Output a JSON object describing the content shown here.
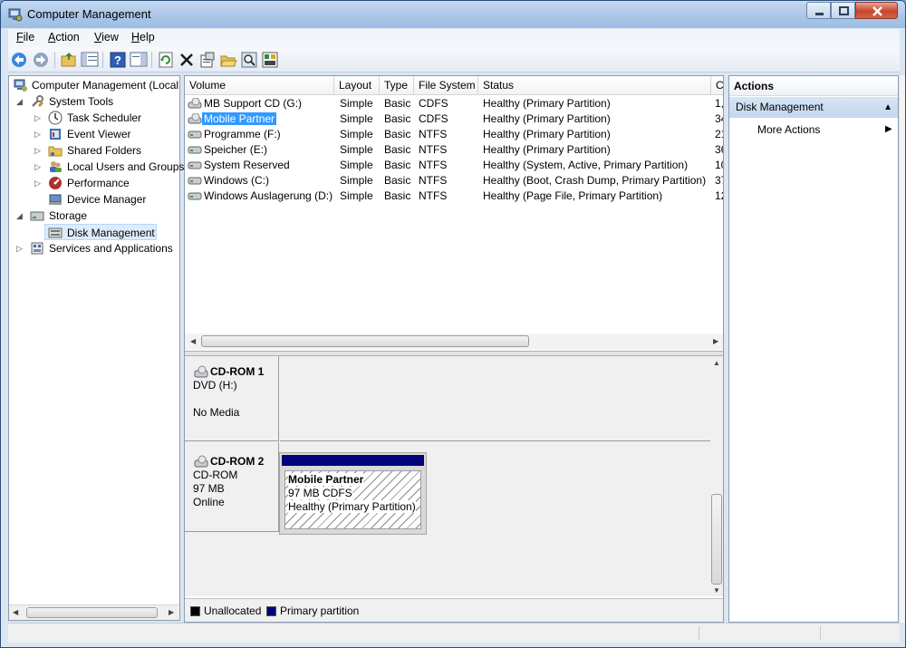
{
  "window": {
    "title": "Computer Management"
  },
  "menu": [
    {
      "label": "File",
      "ul": "F",
      "rest": "ile"
    },
    {
      "label": "Action",
      "ul": "A",
      "rest": "ction"
    },
    {
      "label": "View",
      "ul": "V",
      "rest": "iew"
    },
    {
      "label": "Help",
      "ul": "H",
      "rest": "elp"
    }
  ],
  "tree": {
    "root": "Computer Management (Local",
    "system_tools": "System Tools",
    "task_scheduler": "Task Scheduler",
    "event_viewer": "Event Viewer",
    "shared_folders": "Shared Folders",
    "local_users": "Local Users and Groups",
    "performance": "Performance",
    "device_manager": "Device Manager",
    "storage": "Storage",
    "disk_management": "Disk Management",
    "services": "Services and Applications"
  },
  "volumes": {
    "columns": [
      "Volume",
      "Layout",
      "Type",
      "File System",
      "Status",
      "C"
    ],
    "rows": [
      {
        "volume": "MB Support CD (G:)",
        "layout": "Simple",
        "type": "Basic",
        "fs": "CDFS",
        "status": "Healthy (Primary Partition)",
        "cap": "1,"
      },
      {
        "volume": "Mobile Partner",
        "layout": "Simple",
        "type": "Basic",
        "fs": "CDFS",
        "status": "Healthy (Primary Partition)",
        "cap": "34"
      },
      {
        "volume": "Programme (F:)",
        "layout": "Simple",
        "type": "Basic",
        "fs": "NTFS",
        "status": "Healthy (Primary Partition)",
        "cap": "21"
      },
      {
        "volume": "Speicher (E:)",
        "layout": "Simple",
        "type": "Basic",
        "fs": "NTFS",
        "status": "Healthy (Primary Partition)",
        "cap": "36"
      },
      {
        "volume": "System Reserved",
        "layout": "Simple",
        "type": "Basic",
        "fs": "NTFS",
        "status": "Healthy (System, Active, Primary Partition)",
        "cap": "10"
      },
      {
        "volume": "Windows (C:)",
        "layout": "Simple",
        "type": "Basic",
        "fs": "NTFS",
        "status": "Healthy (Boot, Crash Dump, Primary Partition)",
        "cap": "37"
      },
      {
        "volume": "Windows Auslagerung (D:)",
        "layout": "Simple",
        "type": "Basic",
        "fs": "NTFS",
        "status": "Healthy (Page File, Primary Partition)",
        "cap": "12"
      }
    ]
  },
  "disks": {
    "cdrom1": {
      "name": "CD-ROM 1",
      "line1": "DVD (H:)",
      "line2": "No Media"
    },
    "cdrom2": {
      "name": "CD-ROM 2",
      "line1": "CD-ROM",
      "line2": "97 MB",
      "line3": "Online",
      "partition": {
        "name": "Mobile Partner",
        "size": "97 MB CDFS",
        "status": "Healthy (Primary Partition)"
      }
    }
  },
  "legend": {
    "unallocated": "Unallocated",
    "primary": "Primary partition"
  },
  "actions": {
    "header": "Actions",
    "section": "Disk Management",
    "more": "More Actions"
  },
  "colors": {
    "primary_partition": "#03037a",
    "unallocated": "#000000",
    "selection": "#3399ff"
  }
}
